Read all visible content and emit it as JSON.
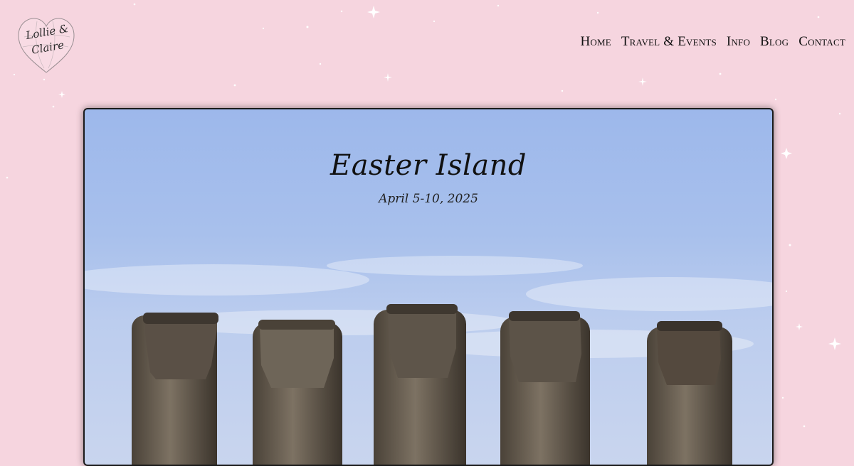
{
  "logo": {
    "line1": "Lollie &",
    "line2": "Claire"
  },
  "nav": {
    "items": [
      {
        "label": "Home"
      },
      {
        "label": "Travel & Events"
      },
      {
        "label": "Info"
      },
      {
        "label": "Blog"
      },
      {
        "label": "Contact"
      }
    ]
  },
  "hero": {
    "title": "Easter Island",
    "date": "April 5-10, 2025"
  },
  "colors": {
    "background": "#f6d5df",
    "sky": "#a8c0ec",
    "text": "#111111"
  }
}
